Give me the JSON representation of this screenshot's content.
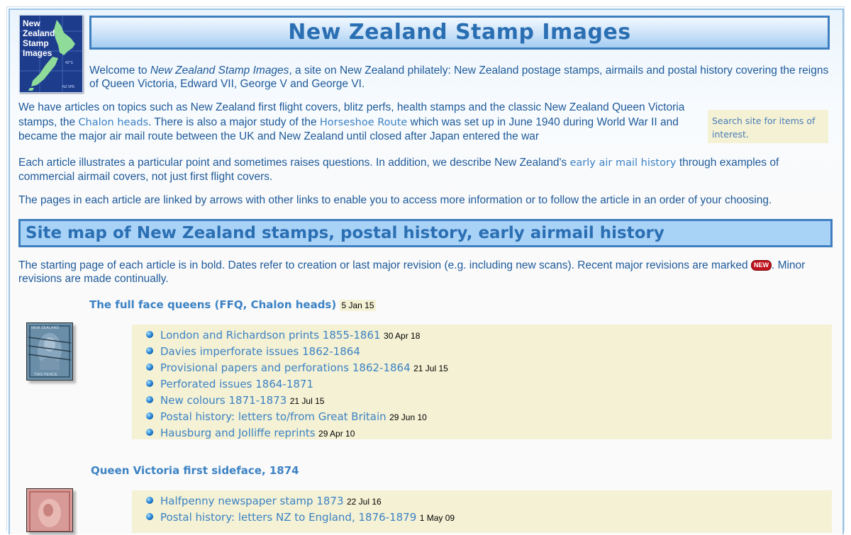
{
  "logo": {
    "text": "New\nZealand\nStamp\nImages",
    "small1": "42°S",
    "small2": "NZ 5PE"
  },
  "header": {
    "title": "New Zealand Stamp Images"
  },
  "intro": {
    "welcome_pre": "Welcome to ",
    "welcome_em": "New Zealand Stamp Images",
    "welcome_post": ", a site on New Zealand philately: New Zealand postage stamps, airmails and postal history covering the reigns of Queen Victoria, Edward VII, George V and George VI.",
    "p1_a": "We have articles on topics such as New Zealand first flight covers, blitz perfs, health stamps and the classic New Zealand Queen Victoria stamps, the ",
    "p1_link1": "Chalon heads",
    "p1_b": ". There is also a major study of the ",
    "p1_link2": "Horseshoe Route",
    "p1_c": " which was set up in June 1940 during World War II and became the major air mail route between the UK and New Zealand until closed after Japan entered the war",
    "p2_a": "Each article illustrates a particular point and sometimes raises questions. In addition, we describe New Zealand's ",
    "p2_link": "early air mail history",
    "p2_b": " through examples of commercial airmail covers, not just first flight covers.",
    "p3": "The pages in each article are linked by arrows with other links to enable you to access more information or to follow the article in an order of your choosing."
  },
  "search": {
    "text": "Search site for items of interest."
  },
  "sitemap": {
    "title": "Site map of New Zealand stamps, postal history, early airmail history",
    "desc_a": "The starting page of each article is in bold. Dates refer to creation or last major revision (e.g. including new scans). Recent major revisions are marked ",
    "new_badge": "NEW",
    "desc_b": ". Minor revisions are made continually."
  },
  "sections": [
    {
      "title": "The full face queens (FFQ, Chalon heads)",
      "date": "5 Jan 15",
      "items": [
        {
          "label": "London and Richardson prints 1855-1861",
          "date": "30 Apr 18"
        },
        {
          "label": "Davies imperforate issues 1862-1864",
          "date": ""
        },
        {
          "label": "Provisional papers and perforations 1862-1864",
          "date": "21 Jul 15"
        },
        {
          "label": "Perforated issues 1864-1871",
          "date": ""
        },
        {
          "label": "New colours 1871-1873",
          "date": "21 Jul 15"
        },
        {
          "label": "Postal history: letters to/from Great Britain",
          "date": "29 Jun 10"
        },
        {
          "label": "Hausburg and Jolliffe reprints",
          "date": "29 Apr 10"
        }
      ]
    },
    {
      "title": "Queen Victoria first sideface, 1874",
      "date": "",
      "items": [
        {
          "label": "Halfpenny newspaper stamp 1873",
          "date": "22 Jul 16"
        },
        {
          "label": "Postal history: letters NZ to England, 1876-1879",
          "date": "1 May 09"
        }
      ]
    }
  ],
  "stamps": {
    "chalon_caption_top": "NEW ZEALAND",
    "chalon_caption_bottom": "TWO PENCE"
  },
  "colors": {
    "link": "#3c82c4",
    "text": "#1e5a9a",
    "panel": "#f4f1d4",
    "header_border": "#3f7fc0"
  }
}
